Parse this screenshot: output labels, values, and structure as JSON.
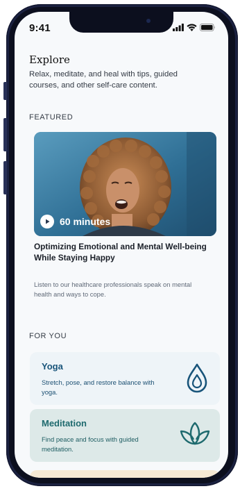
{
  "status_bar": {
    "time": "9:41",
    "icons": [
      "signal-icon",
      "wifi-icon",
      "battery-icon"
    ]
  },
  "header": {
    "title": "Explore",
    "description": "Relax, meditate, and heal with tips, guided courses, and other self-care content."
  },
  "featured": {
    "section_label": "FEATURED",
    "duration_label": "60 minutes",
    "play_icon": "play-icon",
    "title": "Optimizing Emotional and Mental Well-being While Staying Happy",
    "description": "Listen to our healthcare professionals speak on mental health and ways to cope."
  },
  "for_you": {
    "section_label": "FOR YOU",
    "cards": [
      {
        "title": "Yoga",
        "description": "Stretch, pose, and restore balance with yoga.",
        "icon": "water-drop-icon",
        "background": "#eef4f8",
        "accent": "#18547a"
      },
      {
        "title": "Meditation",
        "description": "Find peace and focus with guided meditation.",
        "icon": "lotus-icon",
        "background": "#dde9e8",
        "accent": "#1e6a6e"
      }
    ]
  },
  "colors": {
    "phone_frame": "#1b2140",
    "screen_bg": "#f7f9fb",
    "peek_card": "#f6e9d4"
  }
}
